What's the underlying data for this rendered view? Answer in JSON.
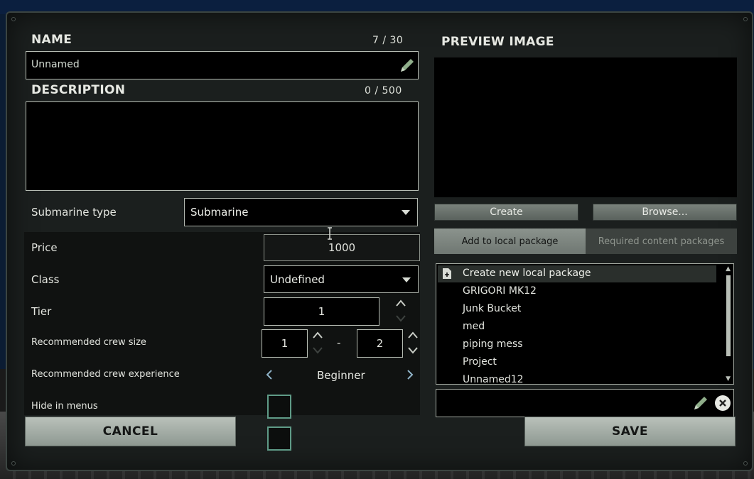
{
  "name_section": {
    "label": "NAME",
    "counter": "7 / 30",
    "value": "Unnamed"
  },
  "description_section": {
    "label": "DESCRIPTION",
    "counter": "0 / 500",
    "value": ""
  },
  "submarine_type": {
    "label": "Submarine type",
    "selected": "Submarine"
  },
  "properties": {
    "price_label": "Price",
    "price_value": "1000",
    "class_label": "Class",
    "class_selected": "Undefined",
    "tier_label": "Tier",
    "tier_value": "1",
    "crew_size_label": "Recommended crew size",
    "crew_size_min": "1",
    "crew_size_sep": "-",
    "crew_size_max": "2",
    "crew_exp_label": "Recommended crew experience",
    "crew_exp_value": "Beginner",
    "hide_label": "Hide in menus"
  },
  "preview": {
    "label": "PREVIEW IMAGE",
    "create_label": "Create",
    "browse_label": "Browse..."
  },
  "package_tabs": [
    {
      "label": "Add to local package",
      "active": true
    },
    {
      "label": "Required content packages",
      "active": false
    }
  ],
  "packages": [
    "Create new local package",
    "GRIGORI MK12",
    "Junk Bucket",
    "med",
    "piping mess",
    "Project",
    "Unnamed12"
  ],
  "package_name_input": "",
  "footer": {
    "cancel_label": "CANCEL",
    "save_label": "SAVE"
  },
  "colors": {
    "panel": "#1b1f1e",
    "checkbox_border": "#5f9b87",
    "button_metal": "#a8b0a9"
  },
  "icons": [
    "pencil-icon",
    "dropdown-caret-icon",
    "chevron-up-icon",
    "chevron-down-icon",
    "chevron-left-icon",
    "chevron-right-icon",
    "new-file-icon",
    "clear-icon"
  ]
}
